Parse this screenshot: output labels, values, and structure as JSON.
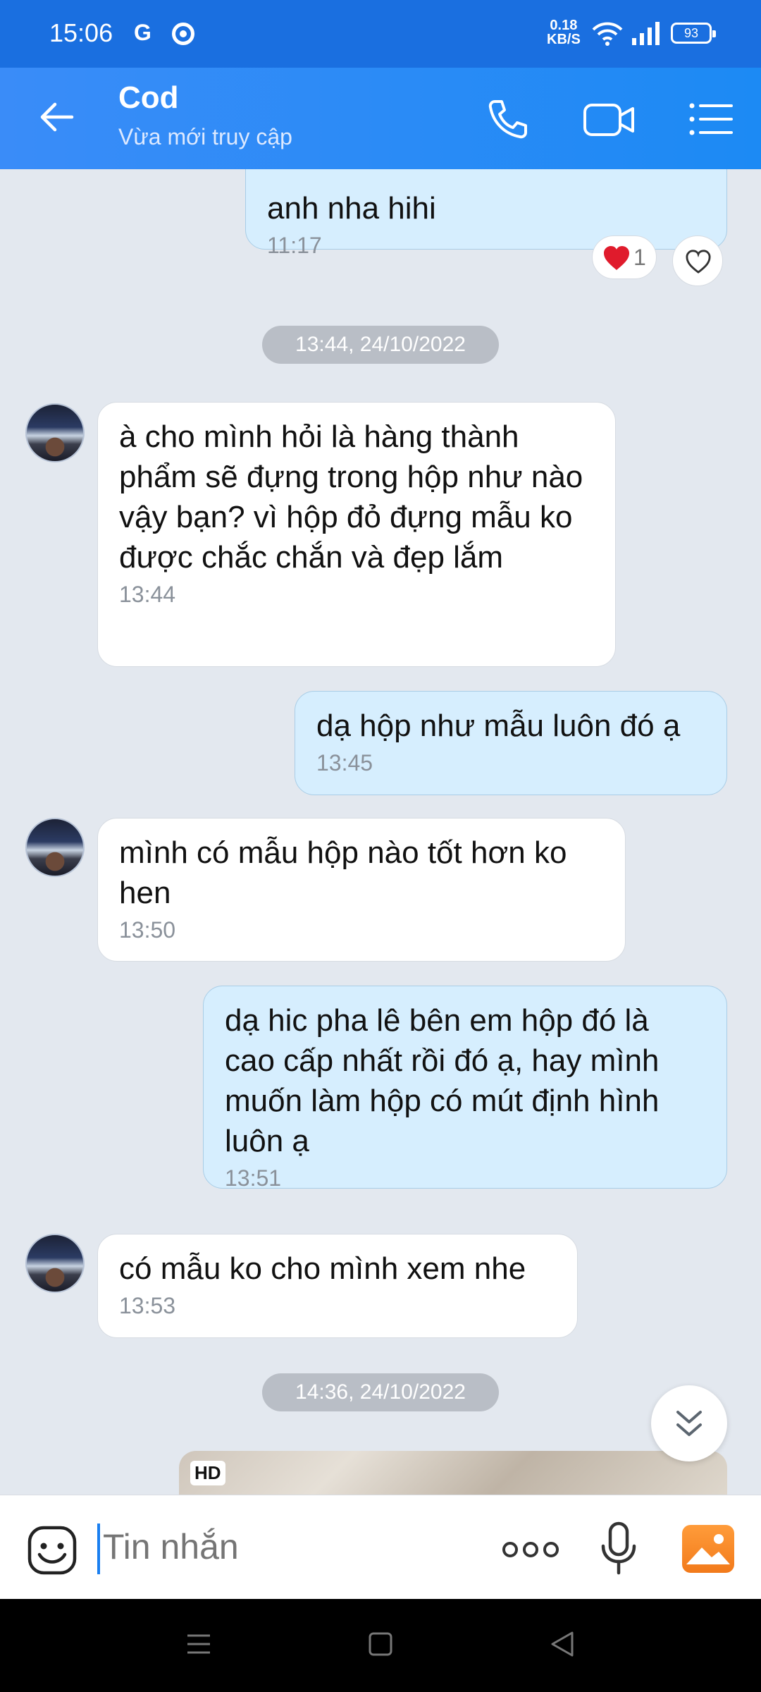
{
  "status": {
    "time": "15:06",
    "speed_value": "0.18",
    "speed_unit": "KB/S",
    "battery": "93"
  },
  "header": {
    "title": "Cod",
    "subtitle": "Vừa mới truy cập"
  },
  "messages": [
    {
      "dir": "out",
      "text": "anh nha hihi",
      "time": "11:17"
    },
    {
      "dir": "in",
      "text": "à cho mình hỏi là hàng thành phẩm sẽ đựng trong hộp như nào vậy bạn? vì hộp đỏ đựng mẫu ko được chắc chắn và đẹp lắm",
      "time": "13:44"
    },
    {
      "dir": "out",
      "text": "dạ hộp như mẫu luôn đó ạ",
      "time": "13:45"
    },
    {
      "dir": "in",
      "text": "mình có mẫu hộp nào tốt hơn ko hen",
      "time": "13:50"
    },
    {
      "dir": "out",
      "text": "dạ hic pha lê bên em hộp đó là cao cấp nhất rồi đó ạ, hay mình muốn làm hộp có mút định hình luôn ạ",
      "time": "13:51"
    },
    {
      "dir": "in",
      "text": "có mẫu ko cho mình xem nhe",
      "time": "13:53"
    }
  ],
  "reaction": {
    "count": "1"
  },
  "date_pills": [
    "13:44, 24/10/2022",
    "14:36, 24/10/2022"
  ],
  "image_badge": "HD",
  "input": {
    "placeholder": "Tin nhắn"
  }
}
